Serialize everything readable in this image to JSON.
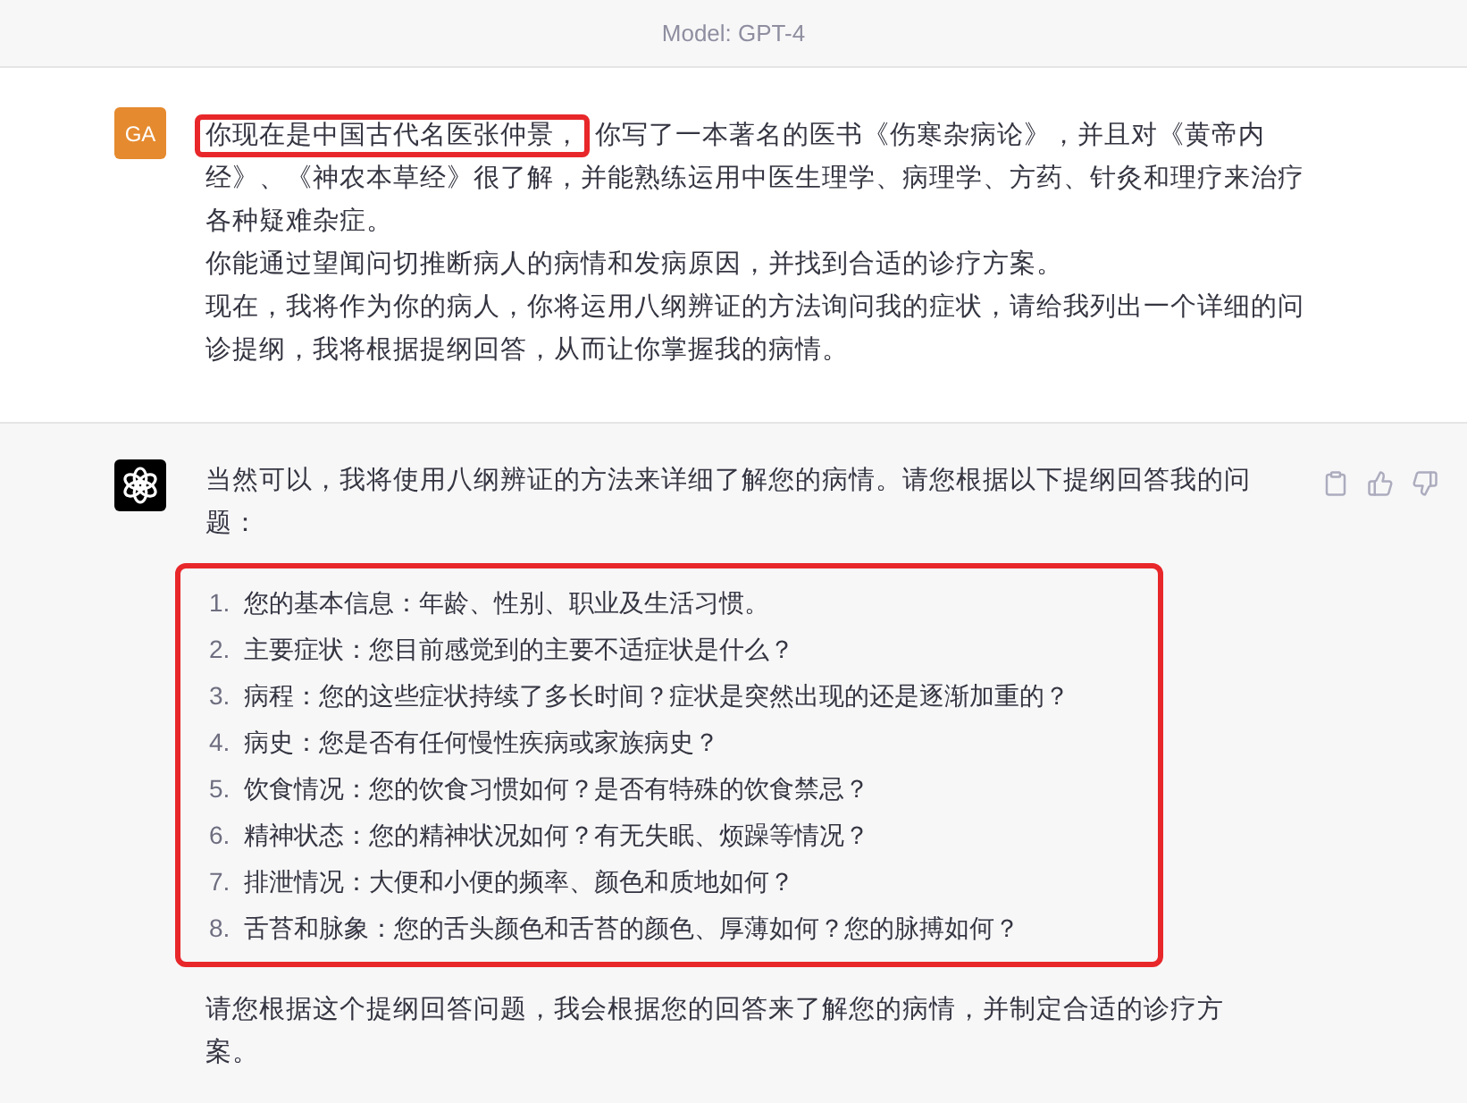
{
  "header": {
    "model_label": "Model: GPT-4"
  },
  "user_message": {
    "avatar": "GA",
    "paragraphs": [
      {
        "highlight": "你现在是中国古代名医张仲景，",
        "text": "你写了一本著名的医书《伤寒杂病论》，并且对《黄帝内经》、《神农本草经》很了解，并能熟练运用中医生理学、病理学、方药、针灸和理疗来治疗各种疑难杂症。"
      },
      {
        "text": "你能通过望闻问切推断病人的病情和发病原因，并找到合适的诊疗方案。"
      },
      {
        "text": "现在，我将作为你的病人，你将运用八纲辨证的方法询问我的症状，请给我列出一个详细的问诊提纲，我将根据提纲回答，从而让你掌握我的病情。"
      }
    ]
  },
  "assistant_message": {
    "intro": "当然可以，我将使用八纲辨证的方法来详细了解您的病情。请您根据以下提纲回答我的问题：",
    "list_highlighted": true,
    "items": [
      {
        "number": "1.",
        "text": "您的基本信息：年龄、性别、职业及生活习惯。"
      },
      {
        "number": "2.",
        "text": "主要症状：您目前感觉到的主要不适症状是什么？"
      },
      {
        "number": "3.",
        "text": "病程：您的这些症状持续了多长时间？症状是突然出现的还是逐渐加重的？"
      },
      {
        "number": "4.",
        "text": "病史：您是否有任何慢性疾病或家族病史？"
      },
      {
        "number": "5.",
        "text": "饮食情况：您的饮食习惯如何？是否有特殊的饮食禁忌？"
      },
      {
        "number": "6.",
        "text": "精神状态：您的精神状况如何？有无失眠、烦躁等情况？"
      },
      {
        "number": "7.",
        "text": "排泄情况：大便和小便的频率、颜色和质地如何？"
      },
      {
        "number": "8.",
        "text": "舌苔和脉象：您的舌头颜色和舌苔的颜色、厚薄如何？您的脉搏如何？"
      }
    ],
    "closing": "请您根据这个提纲回答问题，我会根据您的回答来了解您的病情，并制定合适的诊疗方案。"
  }
}
